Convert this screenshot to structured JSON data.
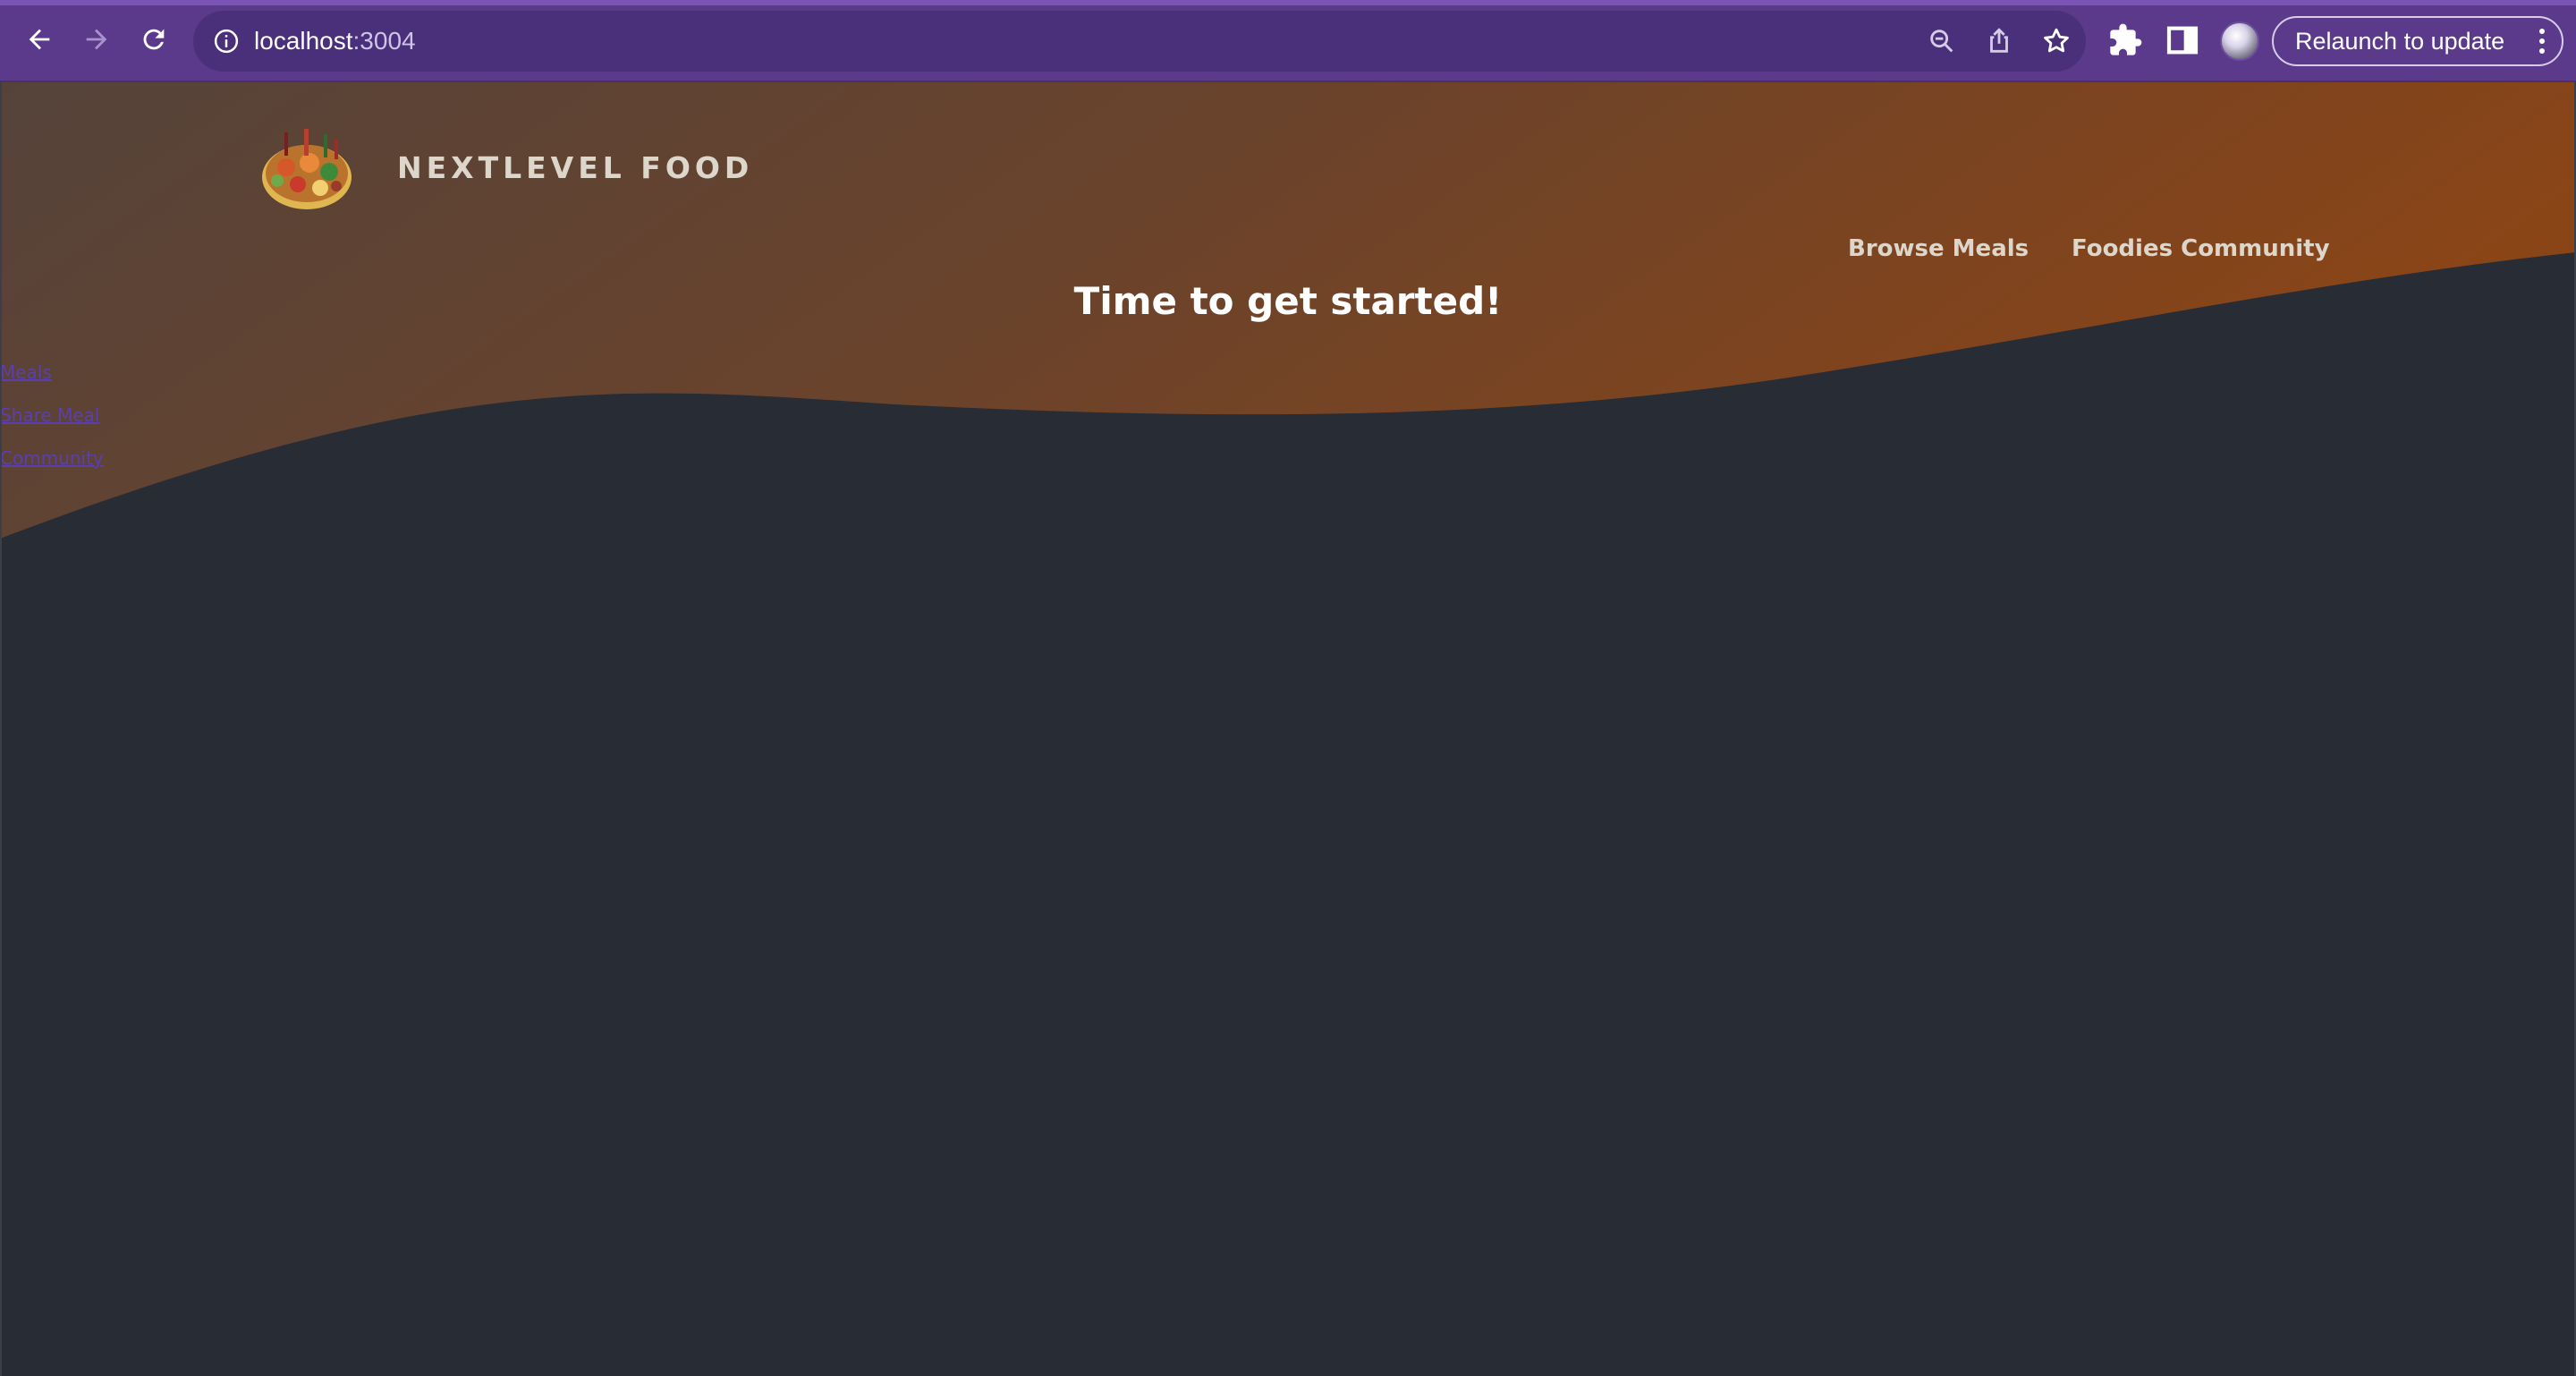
{
  "browser": {
    "url_host": "localhost",
    "url_port": ":3004",
    "relaunch_label": "Relaunch to update",
    "icons": [
      "back-icon",
      "forward-icon",
      "reload-icon",
      "site-info-icon",
      "zoom-icon",
      "share-icon",
      "bookmark-star-icon",
      "extensions-icon",
      "side-panel-icon",
      "profile-avatar",
      "kebab-menu-icon"
    ]
  },
  "header": {
    "logo_text": "NEXTLEVEL FOOD",
    "nav": [
      {
        "label": "Browse Meals"
      },
      {
        "label": "Foodies Community"
      }
    ]
  },
  "main": {
    "title": "Time to get started!"
  },
  "side_links": [
    {
      "label": "Meals"
    },
    {
      "label": "Share Meal"
    },
    {
      "label": "Community"
    }
  ],
  "colors": {
    "chrome": "#5b3a8c",
    "page_bg": "#282c34",
    "gradient_start": "#5a4234",
    "gradient_end": "#8a4518",
    "nav_text": "#ddd6cb",
    "link_purple": "#5b3fae"
  }
}
